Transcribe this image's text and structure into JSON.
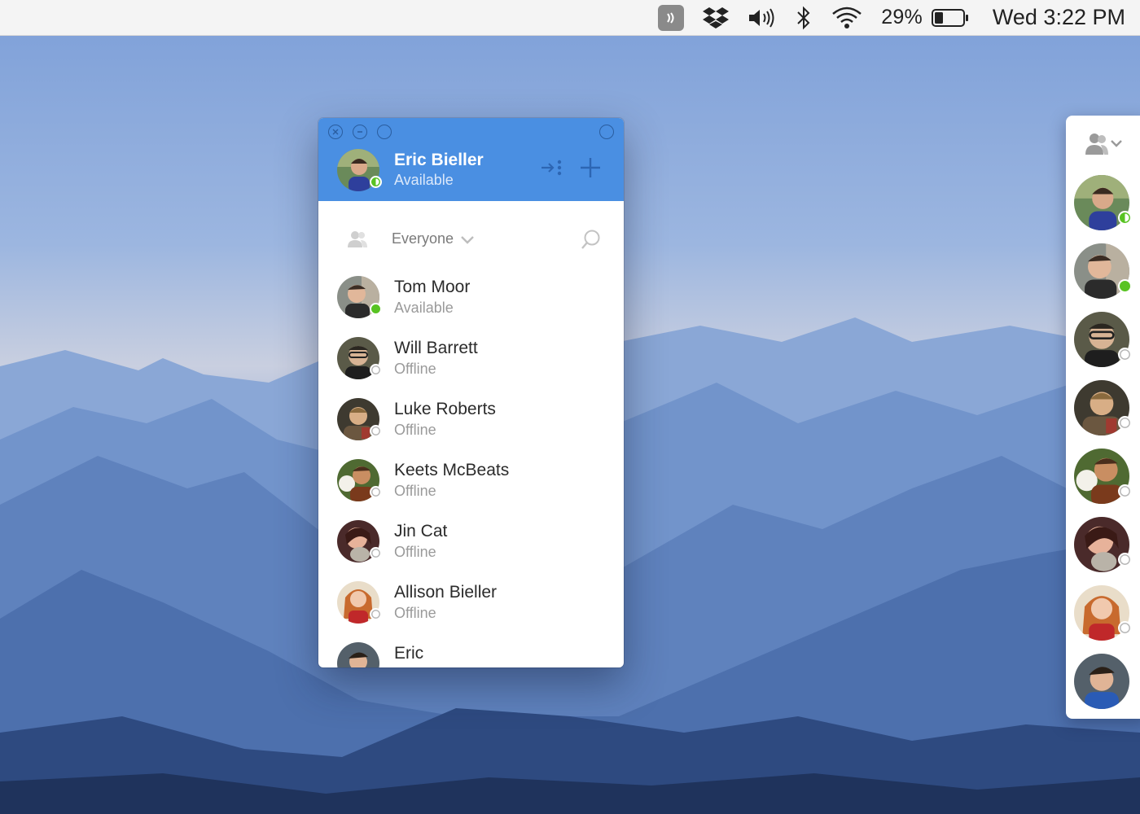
{
  "menubar": {
    "battery_percent": "29%",
    "clock": "Wed 3:22 PM",
    "icons": [
      "menu-app-icon",
      "dropbox-icon",
      "volume-icon",
      "bluetooth-icon",
      "wifi-icon",
      "battery-icon"
    ]
  },
  "window": {
    "user": {
      "name": "Eric Bieller",
      "status": "Available"
    },
    "header_icons": [
      "collapse-icon",
      "add-icon"
    ],
    "filter": {
      "label": "Everyone"
    },
    "contacts": [
      {
        "name": "Tom Moor",
        "status": "Available",
        "presence": "online"
      },
      {
        "name": "Will Barrett",
        "status": "Offline",
        "presence": "offline"
      },
      {
        "name": "Luke Roberts",
        "status": "Offline",
        "presence": "offline"
      },
      {
        "name": "Keets McBeats",
        "status": "Offline",
        "presence": "offline"
      },
      {
        "name": "Jin Cat",
        "status": "Offline",
        "presence": "offline"
      },
      {
        "name": "Allison Bieller",
        "status": "Offline",
        "presence": "offline"
      },
      {
        "name": "Eric",
        "status": "",
        "presence": "none"
      }
    ]
  },
  "dock": {
    "presence": [
      "half",
      "online",
      "offline",
      "offline",
      "offline",
      "offline",
      "offline",
      "none"
    ]
  },
  "colors": {
    "accent": "#4a8fe2",
    "online": "#58c322",
    "text_primary": "#2b2b2b",
    "text_secondary": "#9a9a9a"
  }
}
